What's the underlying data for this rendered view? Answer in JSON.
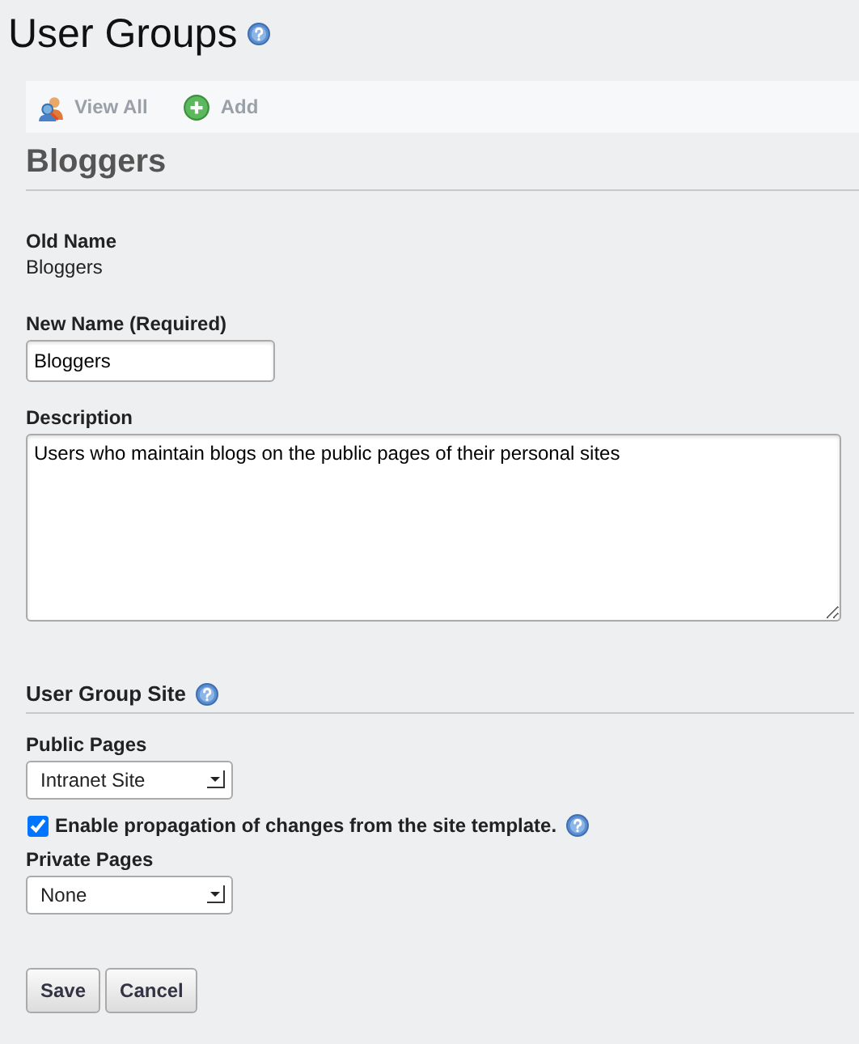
{
  "page": {
    "title": "User Groups"
  },
  "toolbar": [
    {
      "label": "View All"
    },
    {
      "label": "Add"
    }
  ],
  "group": {
    "heading": "Bloggers"
  },
  "old_name": {
    "label": "Old Name",
    "value": "Bloggers"
  },
  "new_name": {
    "label": "New Name (Required)",
    "value": "Bloggers"
  },
  "description": {
    "label": "Description",
    "value": "Users who maintain blogs on the public pages of their personal sites"
  },
  "site": {
    "heading": "User Group Site",
    "public_pages": {
      "label": "Public Pages",
      "value": "Intranet Site"
    },
    "propagation": {
      "label": "Enable propagation of changes from the site template.",
      "checked": true
    },
    "private_pages": {
      "label": "Private Pages",
      "value": "None"
    }
  },
  "buttons": [
    "Save",
    "Cancel"
  ]
}
